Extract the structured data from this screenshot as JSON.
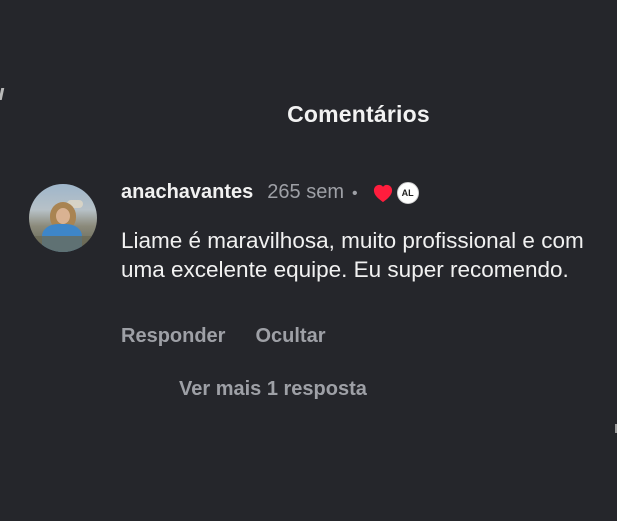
{
  "header": {
    "title": "Comentários"
  },
  "comment": {
    "username": "anachavantes",
    "time": "265 sem",
    "separator": "•",
    "author_badge": "AL",
    "text": "Liame é maravilhosa, muito profissional e com uma excelente equipe. Eu super recomendo.",
    "liked_by_author": true
  },
  "actions": {
    "reply_label": "Responder",
    "hide_label": "Ocultar"
  },
  "replies": {
    "more_label": "Ver mais 1 resposta"
  },
  "colors": {
    "background": "#25262b",
    "primary_text": "#f1f1f1",
    "secondary_text": "#9ea0a6",
    "heart": "#ff1d3d"
  },
  "icons": {
    "heart": "heart-icon",
    "avatar": "user-avatar"
  }
}
